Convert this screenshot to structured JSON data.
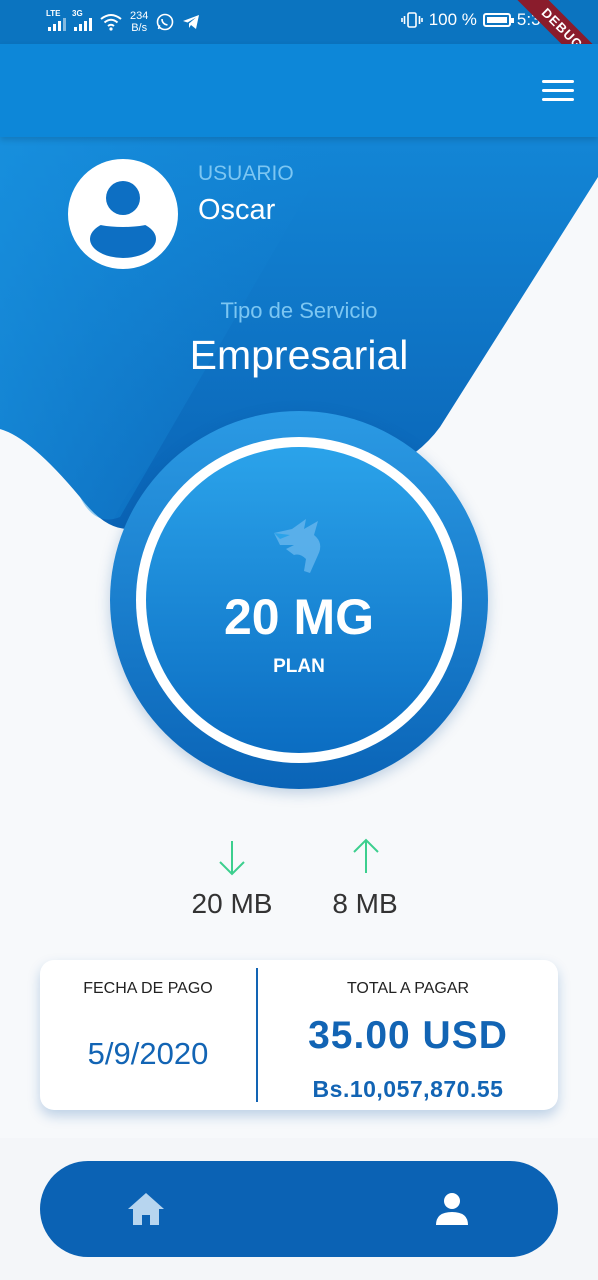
{
  "status_bar": {
    "network_1": "LTE",
    "network_2": "3G",
    "net_speed_value": "234",
    "net_speed_unit": "B/s",
    "battery": "100 %",
    "time": "5:34",
    "debug_banner": "DEBUG"
  },
  "app_bar": {
    "menu_icon": "hamburger-menu-icon"
  },
  "profile": {
    "label": "USUARIO",
    "name": "Oscar",
    "avatar_icon": "person-avatar-icon"
  },
  "service": {
    "label": "Tipo de Servicio",
    "value": "Empresarial"
  },
  "plan": {
    "speed": "20 MG",
    "caption": "PLAN",
    "logo_icon": "wolf-logo-icon"
  },
  "speeds": {
    "download": {
      "icon": "arrow-down-icon",
      "value": "20 MB"
    },
    "upload": {
      "icon": "arrow-up-icon",
      "value": "8 MB"
    }
  },
  "payment": {
    "date_label": "FECHA DE PAGO",
    "date": "5/9/2020",
    "total_label": "TOTAL A PAGAR",
    "total_usd": "35.00 USD",
    "total_bs": "Bs.10,057,870.55"
  },
  "bottom_nav": {
    "home_icon": "home-icon",
    "profile_icon": "person-icon"
  },
  "colors": {
    "primary": "#0d87d8",
    "dark_blue": "#0b62b4",
    "light_label": "#7cc6f2",
    "arrow_green": "#3ccf8e",
    "text_dark": "#333333"
  }
}
